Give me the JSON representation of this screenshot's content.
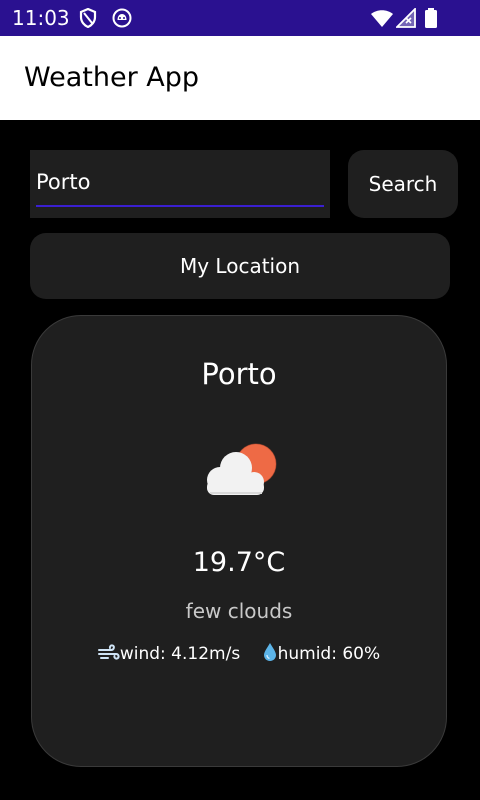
{
  "status_bar": {
    "time": "11:03",
    "background": "#2a1190"
  },
  "app_bar": {
    "title": "Weather App"
  },
  "search": {
    "value": "Porto",
    "button_label": "Search",
    "underline_color": "#3a1fd0"
  },
  "location_button": {
    "label": "My Location"
  },
  "weather": {
    "city": "Porto",
    "icon": "few-clouds-icon",
    "temperature": "19.7°C",
    "description": "few clouds",
    "wind": "wind: 4.12m/s",
    "humidity": "humid: 60%"
  },
  "colors": {
    "surface": "#1f1f1f",
    "background": "#000000",
    "sun": "#ee6a45"
  }
}
